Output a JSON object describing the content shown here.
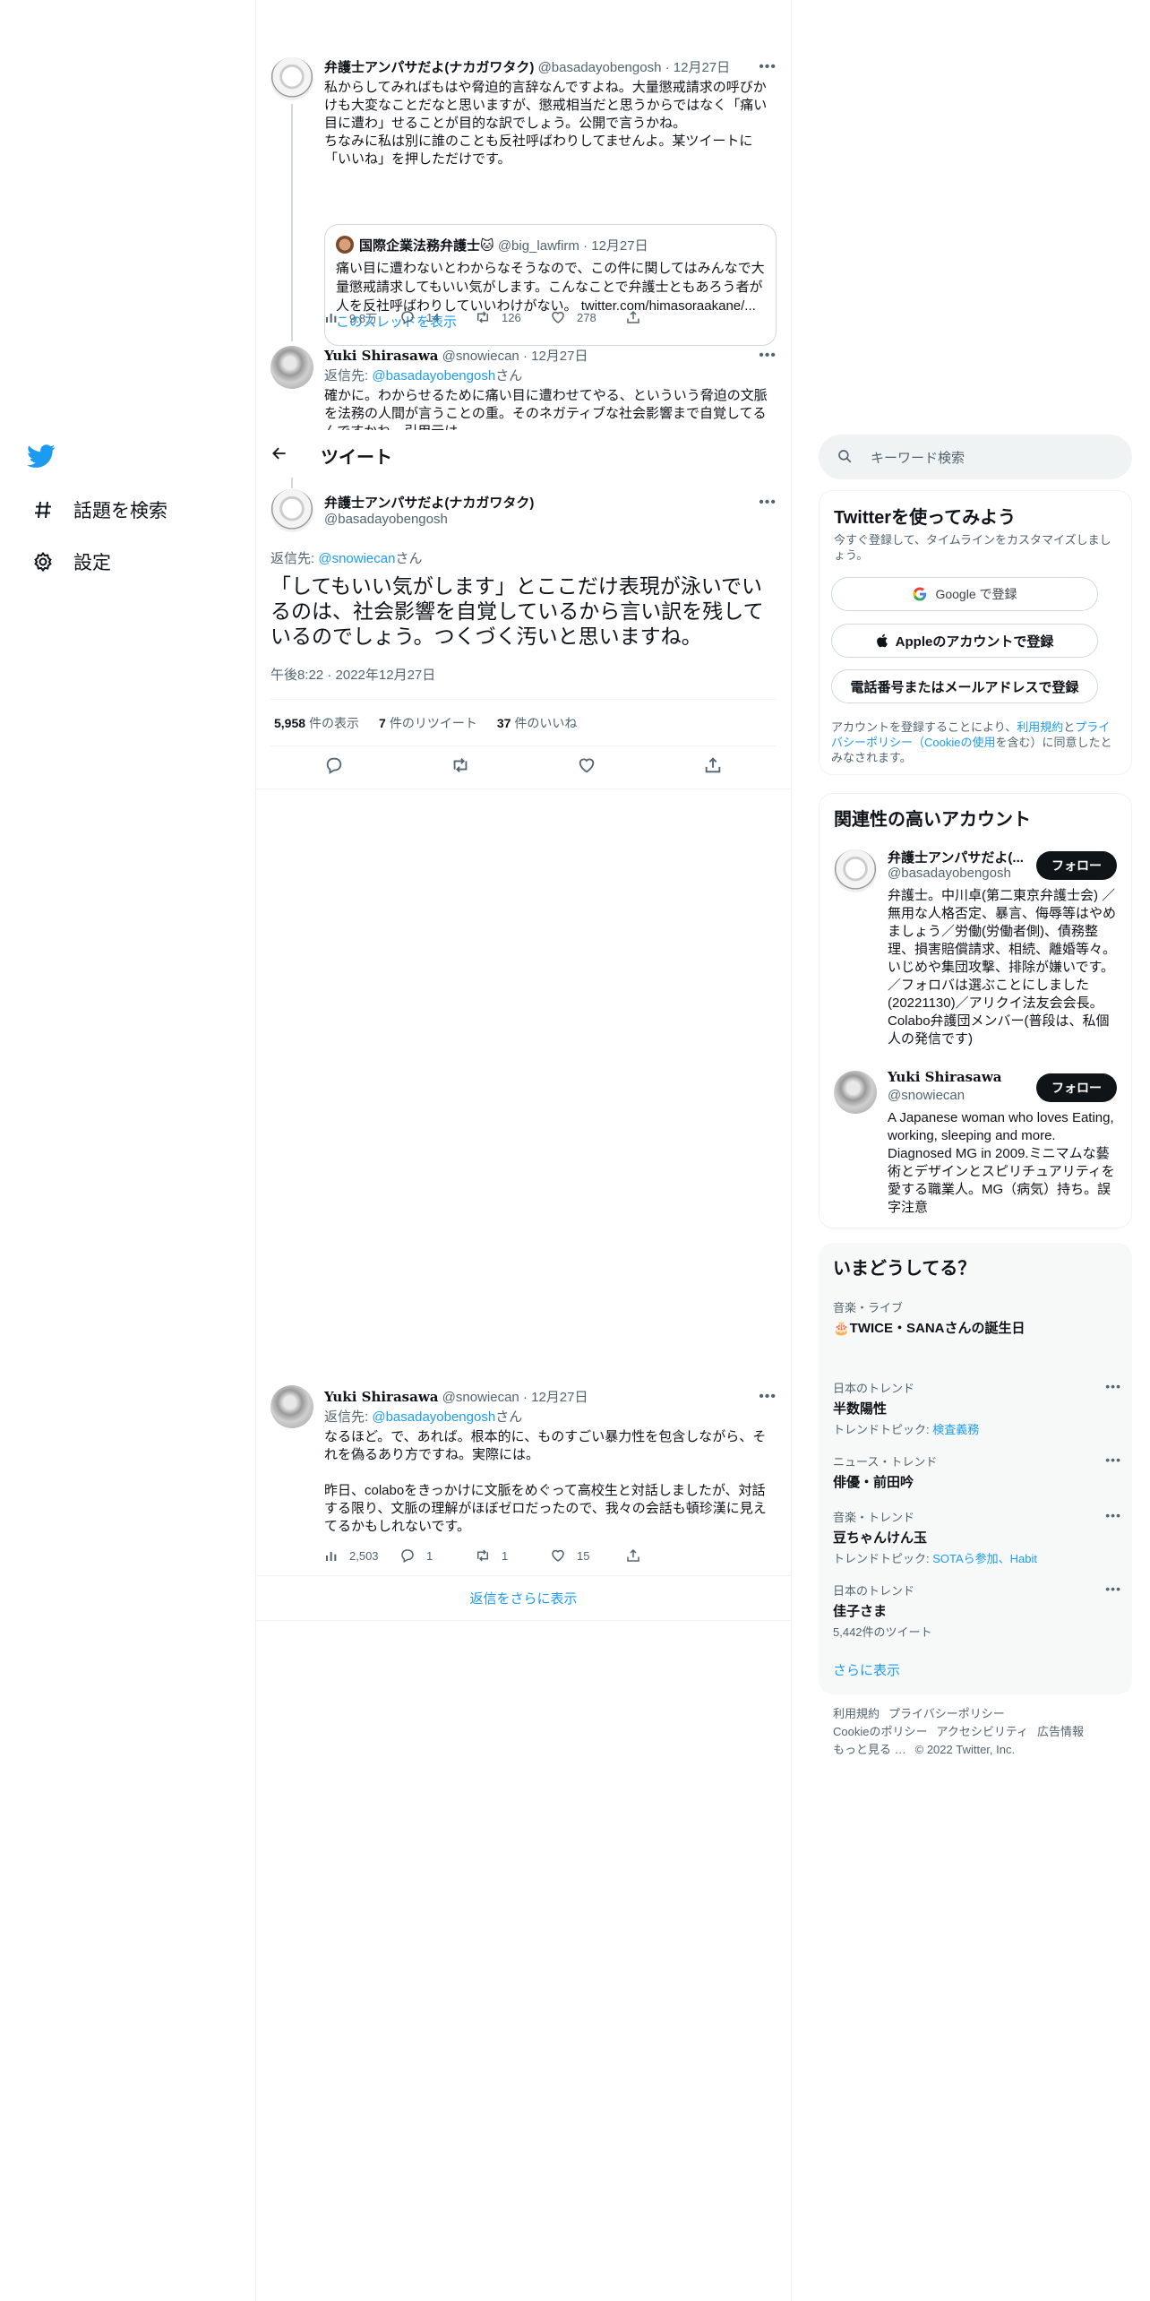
{
  "nav": {
    "items": [
      {
        "label": "話題を検索",
        "icon": "hashtag-icon"
      },
      {
        "label": "設定",
        "icon": "gear-icon"
      }
    ]
  },
  "header": {
    "title": "ツイート"
  },
  "tweets": {
    "t1": {
      "name": "弁護士アンパサだよ(ナカガワタク)",
      "handle": "@basadayobengosh",
      "date": "12月27日",
      "text": "私からしてみればもはや脅迫的言辞なんですよね。大量懲戒請求の呼びかけも大変なことだなと思いますが、懲戒相当だと思うからではなく「痛い目に遭わ」せることが目的な訳でしょう。公開で言うかね。\nちなみに私は別に誰のことも反社呼ばわりしてませんよ。某ツイートに「いいね」を押しただけです。",
      "quote": {
        "name": "国際企業法務弁護士🐱",
        "handle": "@big_lawfirm",
        "date": "12月27日",
        "text": "痛い目に遭わないとわからなそうなので、この件に関してはみんなで大量懲戒請求してもいい気がします。こんなことで弁護士ともあろう者が人を反社呼ばわりしていいわけがない。 twitter.com/himasoraakane/...",
        "show_thread": "このスレッドを表示"
      },
      "views": "9.8万",
      "replies": "14",
      "retweets": "126",
      "likes": "278"
    },
    "t2": {
      "name": "Yuki Shirasawa",
      "handle": "@snowiecan",
      "date": "12月27日",
      "reply_prefix": "返信先: ",
      "reply_to": "@basadayobengosh",
      "reply_suffix": "さん",
      "text": "確かに。わからせるために痛い目に遭わせてやる、といういう脅迫の文脈を法務の人間が言うことの重。そのネガティブな社会影響まで自覚してるんですかね。引用元は"
    },
    "focal": {
      "name": "弁護士アンパサだよ(ナカガワタク)",
      "handle": "@basadayobengosh",
      "reply_prefix": "返信先: ",
      "reply_to": "@snowiecan",
      "reply_suffix": "さん",
      "text": "「してもいい気がします」とここだけ表現が泳いでいるのは、社会影響を自覚しているから言い訳を残しているのでしょう。つくづく汚いと思いますね。",
      "time": "午後8:22 · 2022年12月27日",
      "views": "5,958",
      "views_label": "件の表示",
      "retweets": "7",
      "retweets_label": "件のリツイート",
      "likes": "37",
      "likes_label": "件のいいね"
    },
    "t3": {
      "name": "Yuki Shirasawa",
      "handle": "@snowiecan",
      "date": "12月27日",
      "reply_prefix": "返信先: ",
      "reply_to": "@basadayobengosh",
      "reply_suffix": "さん",
      "text": "なるほど。で、あれば。根本的に、ものすごい暴力性を包含しながら、それを偽るあり方ですね。実際には。\n\n昨日、colaboをきっかけに文脈をめぐって高校生と対話しましたが、対話する限り、文脈の理解がほぼゼロだったので、我々の会話も頓珍漢に見えてるかもしれないです。",
      "views": "2,503",
      "replies": "1",
      "retweets": "1",
      "likes": "15"
    }
  },
  "show_more_replies": "返信をさらに表示",
  "search": {
    "placeholder": "キーワード検索"
  },
  "signup": {
    "title": "Twitterを使ってみよう",
    "subtitle": "今すぐ登録して、タイムラインをカスタマイズしましょう。",
    "google": "Google で登録",
    "apple": "Appleのアカウントで登録",
    "phone": "電話番号またはメールアドレスで登録",
    "legal_1": "アカウントを登録することにより、",
    "legal_terms": "利用規約",
    "legal_2": "と",
    "legal_privacy": "プライバシーポリシー（Cookieの使用",
    "legal_3": "を含む）に同意したとみなされます。"
  },
  "relevant": {
    "title": "関連性の高いアカウント",
    "follow_label": "フォロー",
    "accounts": [
      {
        "name": "弁護士アンパサだよ(...",
        "handle": "@basadayobengosh",
        "bio": "弁護士。中川卓(第二東京弁護士会) ／無用な人格否定、暴言、侮辱等はやめましょう／労働(労働者側)、債務整理、損害賠償請求、相続、離婚等々。いじめや集団攻撃、排除が嫌いです。／フォロバは選ぶことにしました(20221130)／アリクイ法友会会長。Colabo弁護団メンバー(普段は、私個人の発信です)"
      },
      {
        "name": "Yuki Shirasawa",
        "handle": "@snowiecan",
        "bio": "A Japanese woman who loves Eating, working, sleeping and more. Diagnosed MG in 2009.ミニマムな藝術とデザインとスピリチュアリティを愛する職業人。MG（病気）持ち。誤字注意"
      }
    ]
  },
  "trends": {
    "title": "いまどうしてる？",
    "items": [
      {
        "category": "音楽・ライブ",
        "name": "🎂TWICE・SANAさんの誕生日",
        "sub": "",
        "sub_link": ""
      },
      {
        "category": "日本のトレンド",
        "name": "半数陽性",
        "sub": "トレンドトピック: ",
        "sub_link": "検査義務"
      },
      {
        "category": "ニュース・トレンド",
        "name": "俳優・前田吟",
        "sub": "",
        "sub_link": ""
      },
      {
        "category": "音楽・トレンド",
        "name": "豆ちゃんけん玉",
        "sub": "トレンドトピック: ",
        "sub_link": "SOTAら参加、Habit"
      },
      {
        "category": "日本のトレンド",
        "name": "佳子さま",
        "sub": "5,442件のツイート",
        "sub_link": ""
      }
    ],
    "show_more": "さらに表示"
  },
  "footer": {
    "links": [
      "利用規約",
      "プライバシーポリシー",
      "Cookieのポリシー",
      "アクセシビリティ",
      "広告情報",
      "もっと見る …"
    ],
    "copyright": "© 2022 Twitter, Inc."
  },
  "colors": {
    "accent": "#1d9bf0",
    "text": "#0f1419",
    "muted": "#536471",
    "border": "#eff3f4"
  }
}
